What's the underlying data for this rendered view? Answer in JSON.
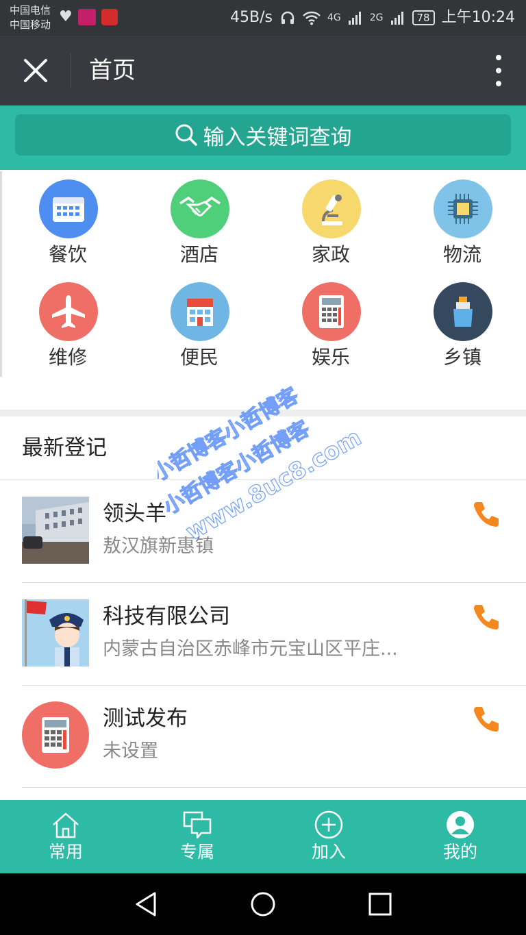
{
  "status_bar": {
    "carrier_1": "中国电信",
    "carrier_2": "中国移动",
    "speed": "45B/s",
    "net_1": "4G",
    "net_2": "2G",
    "battery": "78",
    "time": "上午10:24"
  },
  "title_bar": {
    "title": "首页"
  },
  "search": {
    "placeholder": "输入关键词查询"
  },
  "categories": [
    {
      "label": "餐饮",
      "icon": "calendar-icon",
      "color": "#4d8ef0"
    },
    {
      "label": "酒店",
      "icon": "handshake-icon",
      "color": "#4fcf79"
    },
    {
      "label": "家政",
      "icon": "microscope-icon",
      "color": "#f6d86d"
    },
    {
      "label": "物流",
      "icon": "chip-icon",
      "color": "#7fc3e8"
    },
    {
      "label": "维修",
      "icon": "airplane-icon",
      "color": "#ef6f66"
    },
    {
      "label": "便民",
      "icon": "store-icon",
      "color": "#6fb6e4"
    },
    {
      "label": "娱乐",
      "icon": "calculator-icon",
      "color": "#ef6f66"
    },
    {
      "label": "乡镇",
      "icon": "cruise-ship-icon",
      "color": "#35495e"
    }
  ],
  "section": {
    "title": "最新登记"
  },
  "listings": [
    {
      "name": "领头羊",
      "address": "敖汉旗新惠镇",
      "thumb": "building-photo"
    },
    {
      "name": "科技有限公司",
      "address": "内蒙古自治区赤峰市元宝山区平庄...",
      "thumb": "cartoon-police-photo"
    },
    {
      "name": "测试发布",
      "address": "未设置",
      "thumb": "calculator-icon"
    }
  ],
  "tabs": [
    {
      "label": "常用",
      "icon": "home-icon"
    },
    {
      "label": "专属",
      "icon": "chat-icon"
    },
    {
      "label": "加入",
      "icon": "plus-circle-icon"
    },
    {
      "label": "我的",
      "icon": "user-icon"
    }
  ],
  "watermark": {
    "line_1": "小哲博客小哲博客",
    "line_2": "小哲博客小哲博客",
    "line_3": "www.8uc8.com"
  },
  "colors": {
    "accent": "#2dbba6",
    "title_bar": "#393a3f",
    "phone": "#f5871f"
  }
}
